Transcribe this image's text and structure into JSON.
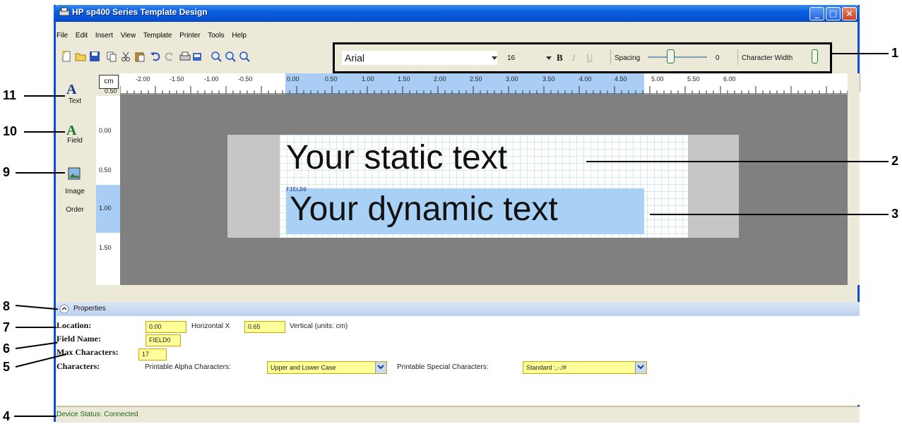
{
  "window": {
    "title": "HP sp400 Series Template Design"
  },
  "menu": [
    "File",
    "Edit",
    "Insert",
    "View",
    "Template",
    "Printer",
    "Tools",
    "Help"
  ],
  "fontbar": {
    "font": "Arial",
    "size": "16",
    "bold": "B",
    "italic": "I",
    "underline": "U",
    "spacing_label": "Spacing",
    "spacing_value": "0",
    "char_width_label": "Character Width",
    "char_width_value": "100"
  },
  "ruler": {
    "unit": "cm",
    "top_ticks": [
      "-2.00",
      "-1.50",
      "-1.00",
      "-0.50",
      "0.00",
      "0.50",
      "1.00",
      "1.50",
      "2.00",
      "2.50",
      "3.00",
      "3.50",
      "4.00",
      "4.50",
      "5.00",
      "5.50",
      "6.00"
    ],
    "left_ticks": [
      "0.50",
      "0.00",
      "0.50",
      "1.00",
      "1.50"
    ]
  },
  "tools": {
    "text_label": "Text",
    "field_label": "Field",
    "image_label": "Image",
    "order_label": "Order"
  },
  "canvas": {
    "static_text": "Your static text",
    "field_tag": "FIELD0",
    "dynamic_text": "Your dynamic text"
  },
  "properties": {
    "header": "Properties",
    "location_label": "Location:",
    "location_x": "0.00",
    "horizontal_label": "Horizontal X",
    "location_y": "0.65",
    "vertical_label": "Vertical (units: cm)",
    "field_name_label": "Field Name:",
    "field_name": "FIELD0",
    "max_chars_label": "Max Characters:",
    "max_chars": "17",
    "characters_label": "Characters:",
    "alpha_label": "Printable Alpha Characters:",
    "alpha_value": "Upper and Lower Case",
    "special_label": "Printable Special Characters:",
    "special_value": "Standard :,-./#"
  },
  "status": {
    "text": "Device Status: Connected"
  },
  "callouts": [
    "1",
    "2",
    "3",
    "4",
    "5",
    "6",
    "7",
    "8",
    "9",
    "10",
    "11"
  ]
}
